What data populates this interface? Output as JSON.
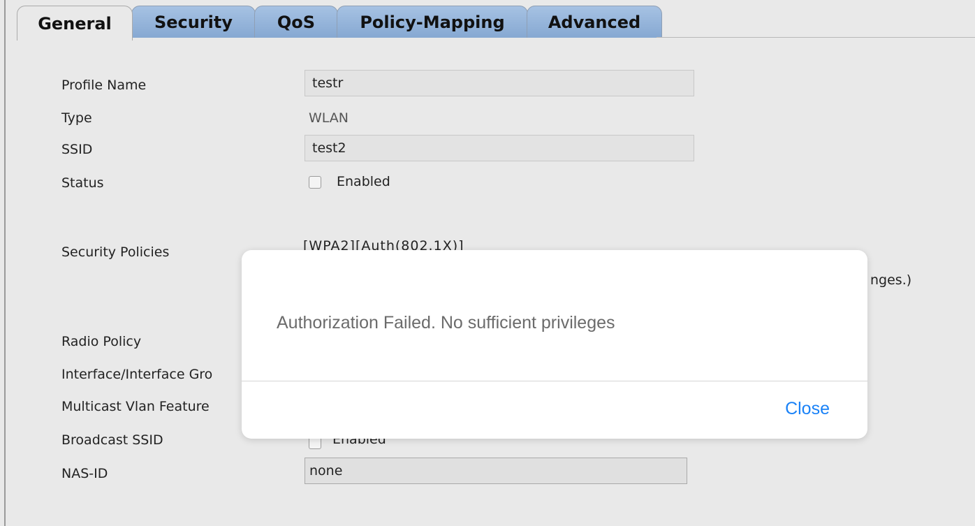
{
  "tabs": [
    {
      "label": "General",
      "active": true
    },
    {
      "label": "Security",
      "active": false
    },
    {
      "label": "QoS",
      "active": false
    },
    {
      "label": "Policy-Mapping",
      "active": false
    },
    {
      "label": "Advanced",
      "active": false
    }
  ],
  "form": {
    "profile_name": {
      "label": "Profile Name",
      "value": "testr"
    },
    "type": {
      "label": "Type",
      "value": "WLAN"
    },
    "ssid": {
      "label": "SSID",
      "value": "test2"
    },
    "status": {
      "label": "Status",
      "checkbox_label": "Enabled",
      "checked": false
    },
    "security_policies": {
      "label": "Security Policies",
      "value_partial": "[WPA2][Auth(802.1X)]",
      "note_partial": "nges.)"
    },
    "radio_policy": {
      "label": "Radio Policy"
    },
    "interface_group": {
      "label": "Interface/Interface Gro"
    },
    "multicast_vlan": {
      "label": "Multicast Vlan Feature"
    },
    "broadcast_ssid": {
      "label": "Broadcast SSID",
      "checkbox_label": "Enabled"
    },
    "nas_id": {
      "label": "NAS-ID",
      "value": "none"
    }
  },
  "modal": {
    "message": "Authorization Failed. No sufficient privileges",
    "close_label": "Close"
  },
  "colors": {
    "tab_inactive": "#96b6dc",
    "link_blue": "#1a82f7",
    "page_bg": "#e9e9e9"
  }
}
